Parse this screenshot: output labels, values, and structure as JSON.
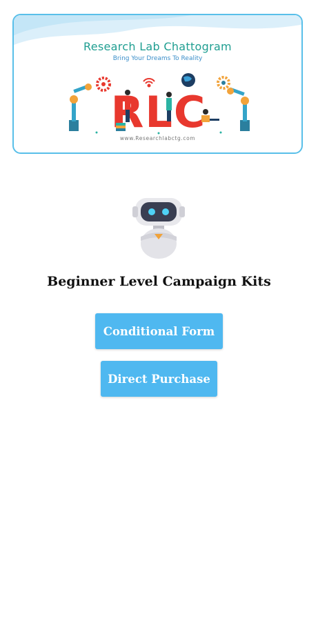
{
  "banner": {
    "title": "Research Lab Chattogram",
    "tagline": "Bring Your Dreams To Reality",
    "logo_text": "RLC",
    "url": "www.Researchlabctg.com",
    "border_color": "#58bfe9",
    "title_color": "#1f9e91",
    "logo_color": "#e8382e"
  },
  "mascot": {
    "icon": "robot-icon"
  },
  "main": {
    "heading": "Beginner Level Campaign Kits",
    "buttons": {
      "conditional_form": "Conditional Form",
      "direct_purchase": "Direct Purchase"
    },
    "button_color": "#4fb8f0"
  }
}
